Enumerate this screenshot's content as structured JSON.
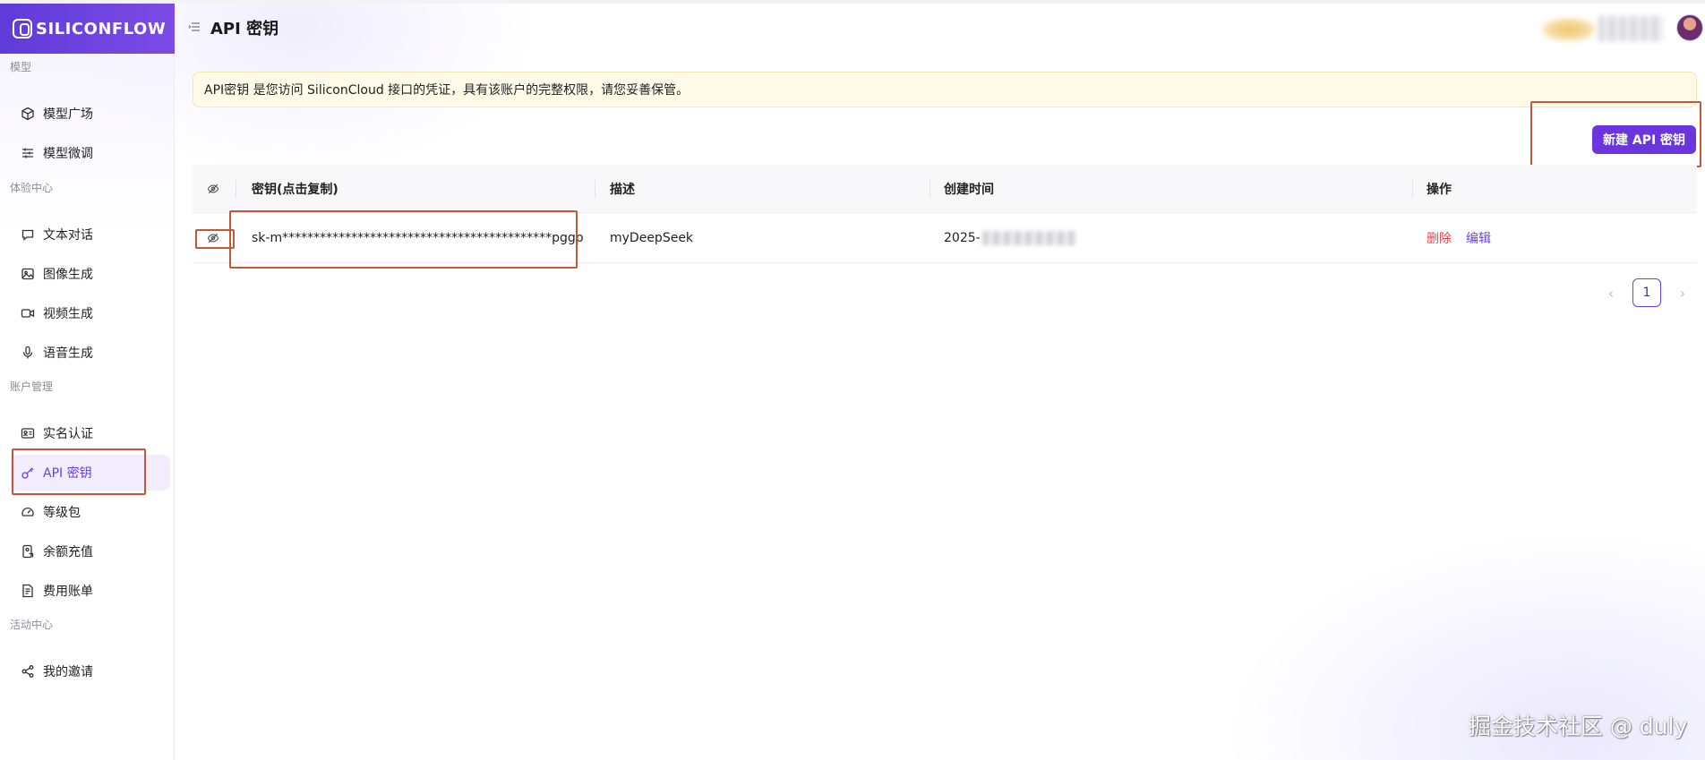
{
  "brand": {
    "logo_text": "SILICONFLOW"
  },
  "header": {
    "title": "API 密钥"
  },
  "sidebar": {
    "sections": [
      {
        "label": "模型",
        "items": [
          {
            "label": "模型广场",
            "icon": "cube-icon"
          },
          {
            "label": "模型微调",
            "icon": "sliders-icon"
          }
        ]
      },
      {
        "label": "体验中心",
        "items": [
          {
            "label": "文本对话",
            "icon": "chat-icon"
          },
          {
            "label": "图像生成",
            "icon": "image-icon"
          },
          {
            "label": "视频生成",
            "icon": "video-icon"
          },
          {
            "label": "语音生成",
            "icon": "mic-icon"
          }
        ]
      },
      {
        "label": "账户管理",
        "items": [
          {
            "label": "实名认证",
            "icon": "id-card-icon"
          },
          {
            "label": "API 密钥",
            "icon": "key-icon",
            "active": true
          },
          {
            "label": "等级包",
            "icon": "gauge-icon"
          },
          {
            "label": "余额充值",
            "icon": "wallet-icon"
          },
          {
            "label": "费用账单",
            "icon": "bill-icon"
          }
        ]
      },
      {
        "label": "活动中心",
        "items": [
          {
            "label": "我的邀请",
            "icon": "share-icon"
          }
        ]
      }
    ]
  },
  "banner": {
    "text": "API密钥 是您访问 SiliconCloud 接口的凭证，具有该账户的完整权限，请您妥善保管。"
  },
  "actions": {
    "new_key_label": "新建 API 密钥"
  },
  "table": {
    "columns": [
      "密钥(点击复制)",
      "描述",
      "创建时间",
      "操作"
    ],
    "rows": [
      {
        "key": "sk-m*******************************************pggp",
        "description": "myDeepSeek",
        "created_visible": "2025-",
        "delete_label": "删除",
        "edit_label": "编辑"
      }
    ]
  },
  "pagination": {
    "current": "1"
  },
  "watermark": {
    "text": "掘金技术社区 @ duly"
  },
  "colors": {
    "accent": "#6b35de",
    "danger": "#e5484d",
    "highlight_box": "#c0593a",
    "banner_bg": "#fffbe8"
  }
}
